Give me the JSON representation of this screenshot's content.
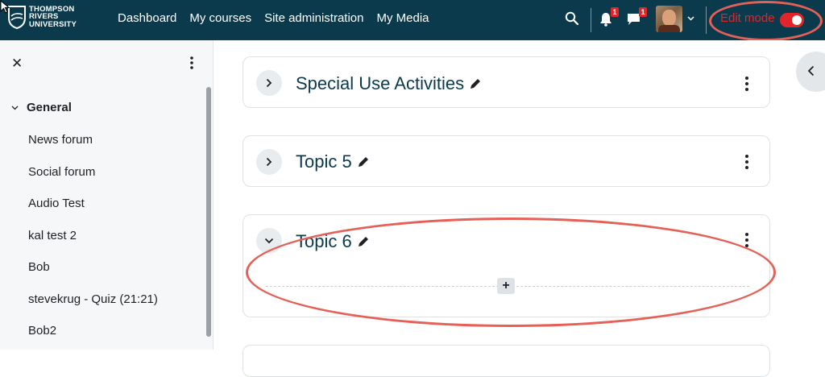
{
  "navbar": {
    "logo_lines": [
      "THOMPSON",
      "RIVERS",
      "UNIVERSITY"
    ],
    "links": [
      "Dashboard",
      "My courses",
      "Site administration",
      "My Media"
    ],
    "notifications_count": "1",
    "messages_count": "1",
    "edit_mode_label": "Edit mode",
    "edit_mode_on": true,
    "accent_color": "#e0262b",
    "bg_color": "#0b3a4d"
  },
  "drawer": {
    "close_icon": "close-icon",
    "section_title": "General",
    "items": [
      "News forum",
      "Social forum",
      "Audio Test",
      "kal test 2",
      "Bob",
      "stevekrug - Quiz (21:21)",
      "Bob2"
    ]
  },
  "sections": [
    {
      "title": "Special Use Activities",
      "collapsed": true
    },
    {
      "title": "Topic 5",
      "collapsed": true
    },
    {
      "title": "Topic 6",
      "collapsed": false,
      "add_label": "+"
    }
  ],
  "annotation_color": "#e56157"
}
